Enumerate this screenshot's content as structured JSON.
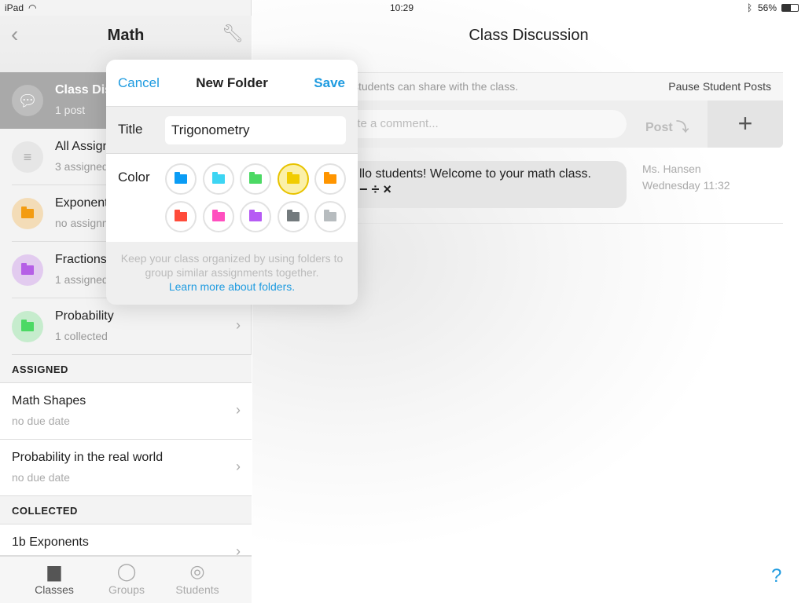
{
  "status": {
    "device": "iPad",
    "time": "10:29",
    "battery": "56%"
  },
  "sidebar": {
    "title": "Math",
    "rows": [
      {
        "title": "Class Discussion",
        "sub": "1 post",
        "color": "#bdbdbd",
        "icon": "chat-bubbles-icon"
      },
      {
        "title": "All Assignments",
        "sub": "3 assigned",
        "color": "#e6e6e6",
        "icon": "list-icon"
      },
      {
        "title": "Exponents",
        "sub": "no assignments",
        "color": "#f39c12",
        "icon": "folder-icon"
      },
      {
        "title": "Fractions",
        "sub": "1 assigned",
        "color": "#b55fe6",
        "icon": "folder-icon"
      },
      {
        "title": "Probability",
        "sub": "1 collected",
        "color": "#4cd964",
        "icon": "folder-icon"
      }
    ],
    "assigned_header": "ASSIGNED",
    "assigned": [
      {
        "title": "Math Shapes",
        "sub": "no due date"
      },
      {
        "title": "Probability in the real world",
        "sub": "no due date"
      }
    ],
    "collected_header": "COLLECTED",
    "collected": [
      {
        "title": "1b Exponents"
      }
    ],
    "tabs": [
      {
        "label": "Classes",
        "active": true
      },
      {
        "label": "Groups"
      },
      {
        "label": "Students"
      }
    ]
  },
  "main": {
    "title": "Class Discussion",
    "banner": "students can share with the class.",
    "pause": "Pause Student Posts",
    "comment_placeholder": "ite a comment...",
    "post": "Post",
    "message": "llo students! Welcome to your math class.",
    "message_symbols": "− ÷ ×",
    "author": "Ms. Hansen",
    "time": "Wednesday 11:32",
    "help": "?"
  },
  "popover": {
    "cancel": "Cancel",
    "title": "New Folder",
    "save": "Save",
    "title_label": "Title",
    "title_value": "Trigonometry",
    "color_label": "Color",
    "colors": [
      "#0a9cf5",
      "#3dd5f3",
      "#4cd964",
      "#f1cc00",
      "#ff9500",
      "#ff4b3a",
      "#ff4fbf",
      "#b65bf4",
      "#737a7d",
      "#b7bcbf"
    ],
    "selected_color": "#f1cc00",
    "footer": "Keep your class organized by using folders to group similar assignments together.",
    "link": "Learn more about folders."
  }
}
